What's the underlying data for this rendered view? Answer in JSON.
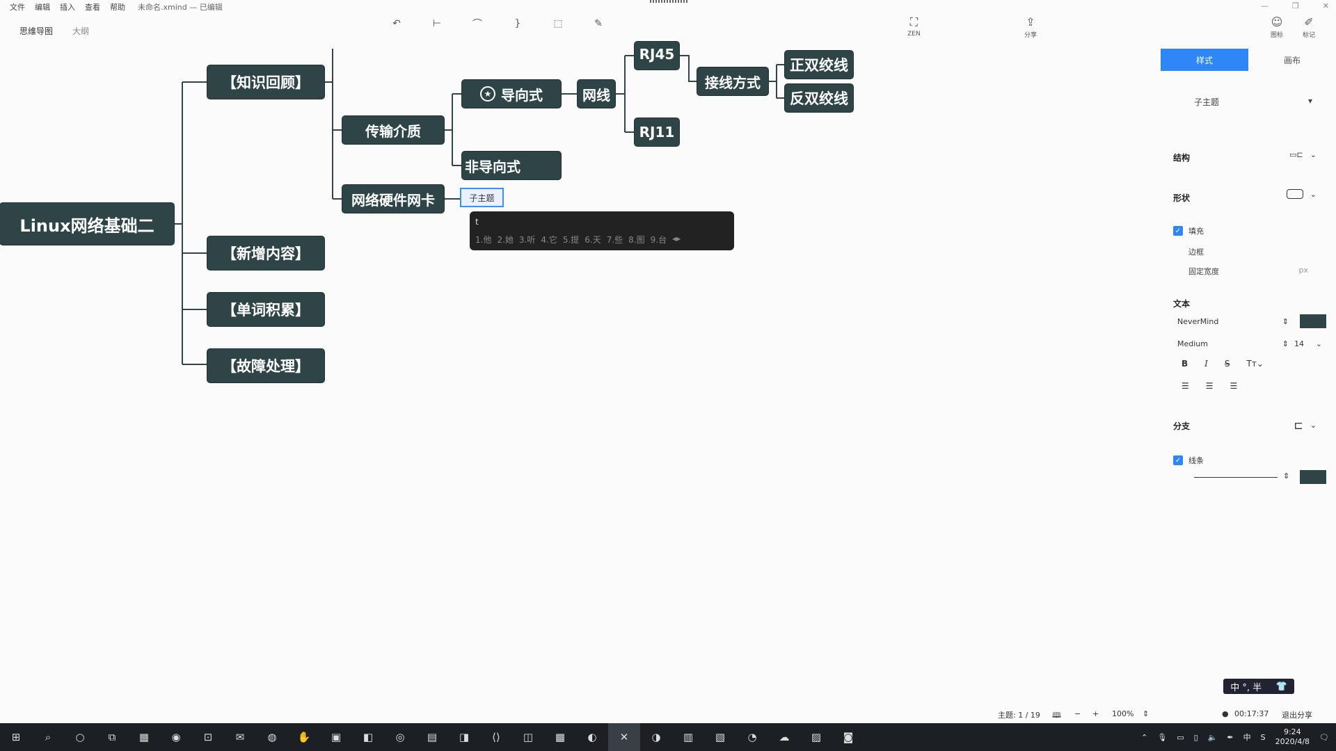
{
  "menu": {
    "items": [
      "文件",
      "编辑",
      "插入",
      "查看",
      "帮助"
    ],
    "title": "未命名.xmind — 已编辑"
  },
  "modes": {
    "mindmap": "思维导图",
    "outline": "大纲"
  },
  "toolbar": {
    "zen_label": "ZEN",
    "share_label": "分享",
    "icons_label": "图标",
    "mark_label": "标记"
  },
  "panel": {
    "tab_style": "样式",
    "tab_canvas": "画布",
    "topic_select": "子主题",
    "structure": "结构",
    "shape": "形状",
    "fill": "填充",
    "border": "边框",
    "fixed_width": "固定宽度",
    "text_section": "文本",
    "font_name": "NeverMind",
    "font_weight": "Medium",
    "font_size": "14",
    "branch": "分支",
    "line": "线条",
    "accent": "#2f86f6",
    "fill_color": "#2e4446"
  },
  "mindmap": {
    "central": "Linux网络基础二",
    "l1": [
      "【知识回顾】",
      "【新增内容】",
      "【单词积累】",
      "【故障处理】"
    ],
    "medium": "传输介质",
    "nic": "网络硬件网卡",
    "guided": "导向式",
    "unguided": "非导向式",
    "cable": "网线",
    "rj45": "RJ45",
    "rj11": "RJ11",
    "wiring": "接线方式",
    "straight": "正双绞线",
    "cross": "反双绞线",
    "editing": "子主题",
    "ime_comp": "t",
    "ime_cands": [
      "1.他",
      "2.她",
      "3.听",
      "4.它",
      "5.提",
      "6.天",
      "7.些",
      "8.图",
      "9.台"
    ]
  },
  "status": {
    "topics": "主题: 1 / 19",
    "zoom": "100%",
    "timer": "00:17:37",
    "exit_share": "退出分享"
  },
  "ime_indicator": "中 °, 半",
  "clock": {
    "time": "9:24",
    "date": "2020/4/8"
  }
}
